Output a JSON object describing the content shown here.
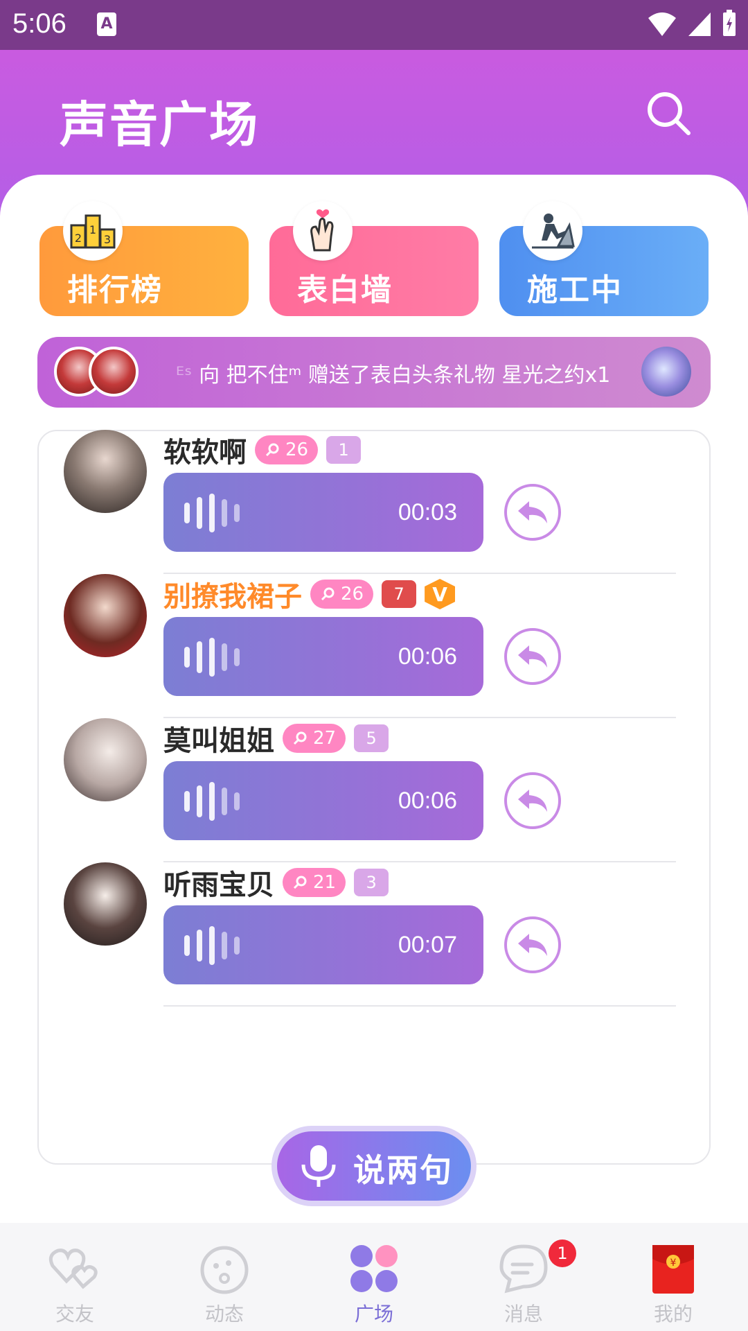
{
  "status": {
    "time": "5:06",
    "a_icon": "A"
  },
  "header": {
    "title": "声音广场",
    "search_icon": "search-icon"
  },
  "categories": [
    {
      "label": "排行榜",
      "icon": "podium-icon",
      "color": "#ff9a3c"
    },
    {
      "label": "表白墙",
      "icon": "heart-finger-icon",
      "color": "#ff6b98"
    },
    {
      "label": "施工中",
      "icon": "construction-icon",
      "color": "#4f8ff0"
    }
  ],
  "ticker": {
    "fade_text": "ᴱˢ",
    "message": "向 把不住ᵐ 赠送了表白头条礼物 星光之约x1"
  },
  "posts": [
    {
      "name": "软软啊",
      "name_color": "#2a2a2a",
      "level": "26",
      "rank": "1",
      "rank_color": "#d9a7e8",
      "duration": "00:03",
      "vip": ""
    },
    {
      "name": "别撩我裙子",
      "name_color": "#ff8a2a",
      "level": "26",
      "rank": "7",
      "rank_color": "#e04c4c",
      "duration": "00:06",
      "vip": "V"
    },
    {
      "name": "莫叫姐姐",
      "name_color": "#2a2a2a",
      "level": "27",
      "rank": "5",
      "rank_color": "#d9a7e8",
      "duration": "00:06",
      "vip": ""
    },
    {
      "name": "听雨宝贝",
      "name_color": "#2a2a2a",
      "level": "21",
      "rank": "3",
      "rank_color": "#d9a7e8",
      "duration": "00:07",
      "vip": ""
    }
  ],
  "speak_button": {
    "label": "说两句"
  },
  "tabs": [
    {
      "label": "交友",
      "icon": "hearts-icon",
      "active": false
    },
    {
      "label": "动态",
      "icon": "face-icon",
      "active": false
    },
    {
      "label": "广场",
      "icon": "grid-bubbles-icon",
      "active": true
    },
    {
      "label": "消息",
      "icon": "chat-icon",
      "active": false,
      "badge": "1"
    },
    {
      "label": "我的",
      "icon": "red-envelope-icon",
      "active": false
    }
  ]
}
